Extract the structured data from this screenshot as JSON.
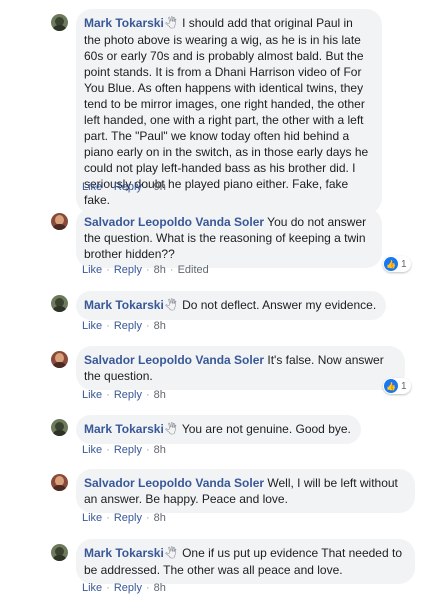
{
  "comments": [
    {
      "author": "Mark Tokarski",
      "badge": "🖑",
      "text": "I should add that original Paul in the photo above is wearing a wig, as he is in his late 60s or early 70s and is probably almost bald. But the point stands. It is from a Dhani Harrison video of For You Blue. As often happens with identical twins, they tend to be mirror images, one right handed, the other left handed, one with a right part, the other with a left part. The \"Paul\" we know today often hid behind a piano early on in the switch, as in those early days he could not play left-handed bass as his brother did. I seriously doubt he played piano either. Fake, fake fake.",
      "like": "Like",
      "reply": "Reply",
      "time": "9h",
      "edited": "",
      "reactions": ""
    },
    {
      "author": "Salvador Leopoldo Vanda Soler",
      "badge": "",
      "text": "You do not answer the question. What is the reasoning of keeping a twin brother hidden??",
      "like": "Like",
      "reply": "Reply",
      "time": "8h",
      "edited": "Edited",
      "reactions": "1"
    },
    {
      "author": "Mark Tokarski",
      "badge": "🖑",
      "text": "Do not deflect. Answer my evidence.",
      "like": "Like",
      "reply": "Reply",
      "time": "8h",
      "edited": "",
      "reactions": ""
    },
    {
      "author": "Salvador Leopoldo Vanda Soler",
      "badge": "",
      "text": "It's false. Now answer the question.",
      "like": "Like",
      "reply": "Reply",
      "time": "8h",
      "edited": "",
      "reactions": "1"
    },
    {
      "author": "Mark Tokarski",
      "badge": "🖑",
      "text": "You are not genuine. Good bye.",
      "like": "Like",
      "reply": "Reply",
      "time": "8h",
      "edited": "",
      "reactions": ""
    },
    {
      "author": "Salvador Leopoldo Vanda Soler",
      "badge": "",
      "text": "Well, I will be left without an answer. Be happy. Peace and love.",
      "like": "Like",
      "reply": "Reply",
      "time": "8h",
      "edited": "",
      "reactions": ""
    },
    {
      "author": "Mark Tokarski",
      "badge": "🖑",
      "text": "One if us put up evidence That needed to be addressed. The other was all peace and love.",
      "like": "Like",
      "reply": "Reply",
      "time": "8h",
      "edited": "",
      "reactions": ""
    }
  ]
}
